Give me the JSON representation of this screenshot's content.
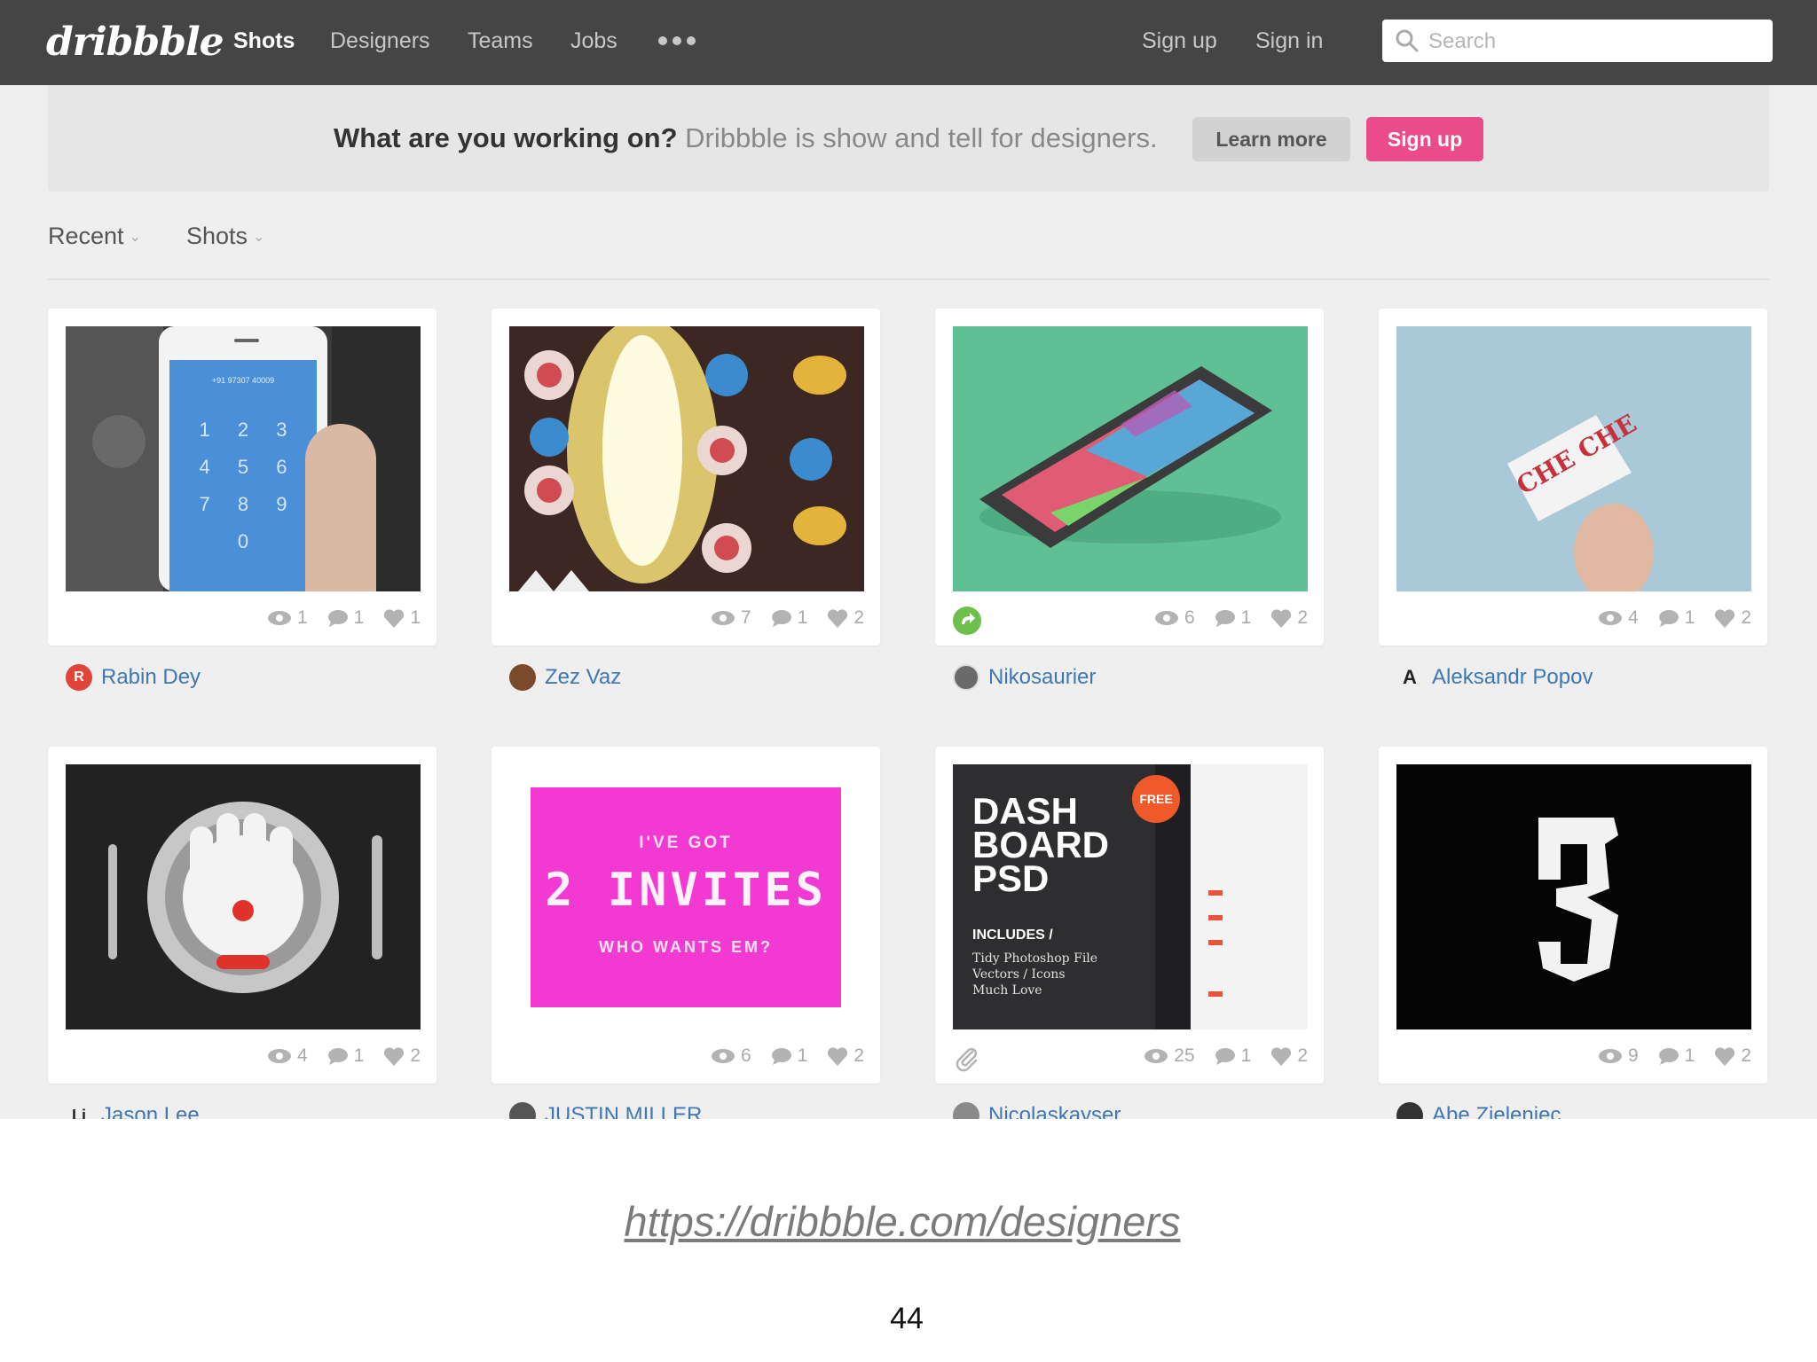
{
  "header": {
    "logo": "dribbble",
    "nav": [
      "Shots",
      "Designers",
      "Teams",
      "Jobs"
    ],
    "sign_up": "Sign up",
    "sign_in": "Sign in",
    "search_placeholder": "Search"
  },
  "banner": {
    "strong": "What are you working on?",
    "rest": "Dribbble is show and tell for designers.",
    "learn_more": "Learn more",
    "sign_up": "Sign up"
  },
  "filters": {
    "sort": "Recent",
    "type": "Shots"
  },
  "shots": [
    {
      "views": "1",
      "comments": "1",
      "likes": "1",
      "author": "Rabin Dey",
      "avatar": "R"
    },
    {
      "views": "7",
      "comments": "1",
      "likes": "2",
      "author": "Zez Vaz",
      "avatar": ""
    },
    {
      "views": "6",
      "comments": "1",
      "likes": "2",
      "author": "Nikosaurier",
      "avatar": ""
    },
    {
      "views": "4",
      "comments": "1",
      "likes": "2",
      "author": "Aleksandr Popov",
      "avatar": "A"
    },
    {
      "views": "4",
      "comments": "1",
      "likes": "2",
      "author": "Jason Lee",
      "avatar": "Li"
    },
    {
      "views": "6",
      "comments": "1",
      "likes": "2",
      "author": "JUSTIN MILLER",
      "avatar": ""
    },
    {
      "views": "25",
      "comments": "1",
      "likes": "2",
      "author": "Nicolaskayser",
      "avatar": ""
    },
    {
      "views": "9",
      "comments": "1",
      "likes": "2",
      "author": "Abe Zieleniec",
      "avatar": ""
    }
  ],
  "shot_art": {
    "phone_number": "+91 97307 40009",
    "keypad": [
      "1",
      "2",
      "3",
      "4",
      "5",
      "6",
      "7",
      "8",
      "9",
      "0"
    ],
    "business_card": "CHE CHE",
    "invite_line1": "I'VE GOT",
    "invite_line2": "2 INVITES",
    "invite_line3": "WHO WANTS EM?",
    "dash_title": "DASH BOARD PSD",
    "dash_badge": "FREE",
    "dash_includes": "INCLUDES /",
    "dash_list": [
      "Tidy Photoshop File",
      "Vectors / Icons",
      "Much Love"
    ]
  },
  "caption": {
    "url": "https://dribbble.com/designers",
    "page": "44"
  },
  "colors": {
    "topbar": "#454545",
    "pink": "#ea4c89",
    "link": "#3e77b3"
  }
}
